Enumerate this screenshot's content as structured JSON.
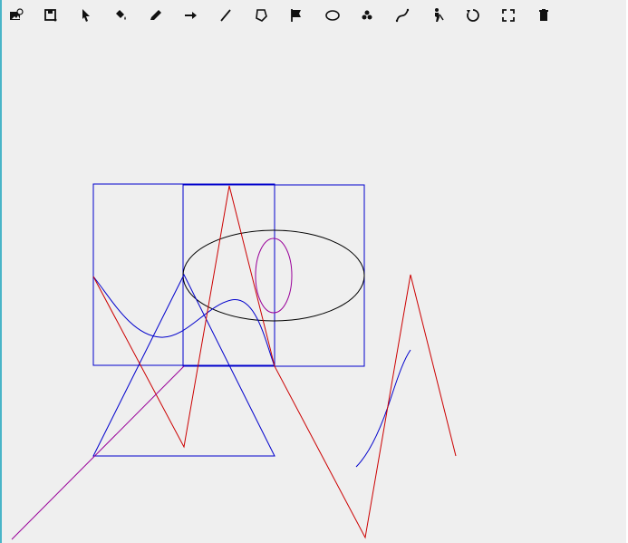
{
  "toolbar": {
    "tools": [
      {
        "id": "open",
        "icon": "open-image-icon"
      },
      {
        "id": "save",
        "icon": "save-icon"
      },
      {
        "id": "select",
        "icon": "pointer-icon"
      },
      {
        "id": "fill",
        "icon": "paint-bucket-icon"
      },
      {
        "id": "pencil",
        "icon": "pencil-icon"
      },
      {
        "id": "arrow",
        "icon": "arrow-right-icon"
      },
      {
        "id": "line",
        "icon": "line-icon"
      },
      {
        "id": "polygon",
        "icon": "polygon-icon"
      },
      {
        "id": "flag",
        "icon": "flag-icon"
      },
      {
        "id": "ellipse",
        "icon": "ellipse-icon"
      },
      {
        "id": "spiral",
        "icon": "spiral-icon"
      },
      {
        "id": "curve",
        "icon": "curve-icon"
      },
      {
        "id": "figure",
        "icon": "figure-icon"
      },
      {
        "id": "rotate",
        "icon": "rotate-icon"
      },
      {
        "id": "fullscreen",
        "icon": "fullscreen-icon"
      },
      {
        "id": "delete",
        "icon": "trash-icon"
      }
    ]
  },
  "colors": {
    "background": "#efefef",
    "blue": "#0000cc",
    "red": "#cc0000",
    "purple": "#990099",
    "black": "#000000",
    "left_edge": "#49b5c8"
  }
}
